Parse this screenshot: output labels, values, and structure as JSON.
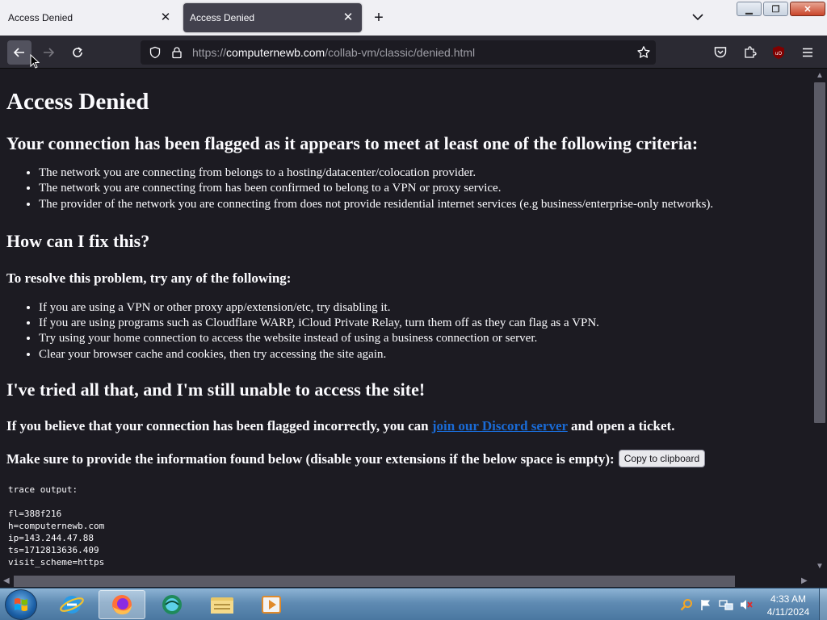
{
  "browser": {
    "tabs": [
      {
        "title": "Access Denied",
        "active": false
      },
      {
        "title": "Access Denied",
        "active": true
      }
    ],
    "url_prefix": "https://",
    "url_host": "computernewb.com",
    "url_path": "/collab-vm/classic/denied.html"
  },
  "page": {
    "title": "Access Denied",
    "flagged_heading": "Your connection has been flagged as it appears to meet at least one of the following criteria:",
    "criteria": [
      "The network you are connecting from belongs to a hosting/datacenter/colocation provider.",
      "The network you are connecting from has been confirmed to belong to a VPN or proxy service.",
      "The provider of the network you are connecting from does not provide residential internet services (e.g business/enterprise-only networks)."
    ],
    "fix_heading": "How can I fix this?",
    "resolve_heading": "To resolve this problem, try any of the following:",
    "fixes": [
      "If you are using a VPN or other proxy app/extension/etc, try disabling it.",
      "If you are using programs such as Cloudflare WARP, iCloud Private Relay, turn them off as they can flag as a VPN.",
      "Try using your home connection to access the website instead of using a business connection or server.",
      "Clear your browser cache and cookies, then try accessing the site again."
    ],
    "tried_heading": "I've tried all that, and I'm still unable to access the site!",
    "incorrect_prefix": "If you believe that your connection has been flagged incorrectly, you can ",
    "discord_link": "join our Discord server",
    "incorrect_suffix": " and open a ticket.",
    "info_text": "Make sure to provide the information found below (disable your extensions if the below space is empty):",
    "copy_button": "Copy to clipboard",
    "trace_label": "trace output:",
    "trace_lines": [
      "fl=388f216",
      "h=computernewb.com",
      "ip=143.244.47.88",
      "ts=1712813636.409",
      "visit_scheme=https"
    ]
  },
  "taskbar": {
    "time": "4:33 AM",
    "date": "4/11/2024"
  },
  "colors": {
    "page_bg": "#1c1b22",
    "link": "#1a6bd6",
    "toolbar": "#2b2a33"
  }
}
